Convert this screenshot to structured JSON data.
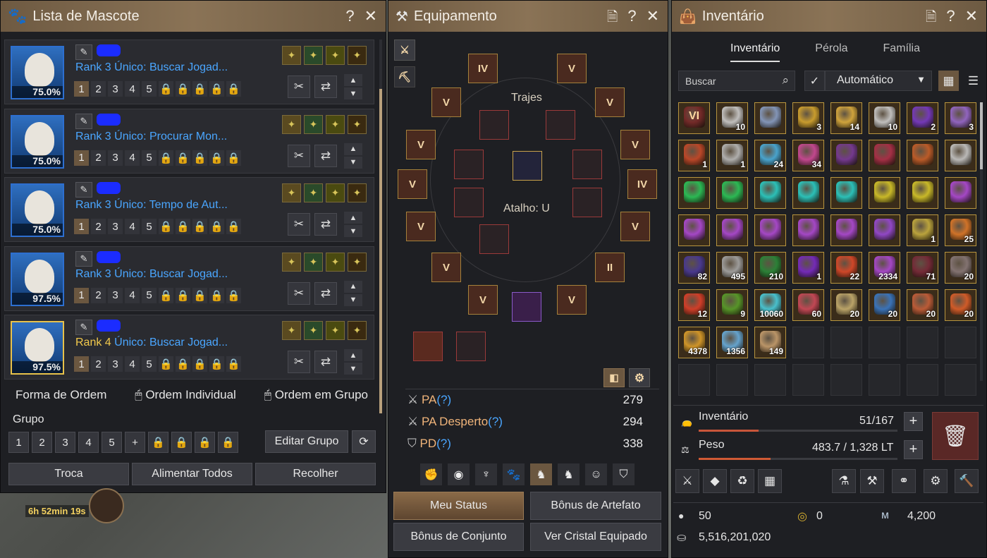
{
  "pets": {
    "title": "Lista de Mascote",
    "items": [
      {
        "pct": "75.0%",
        "rank": "Rank 3",
        "skill": "Único: Buscar Jogad...",
        "gold": false
      },
      {
        "pct": "75.0%",
        "rank": "Rank 3",
        "skill": "Único: Procurar Mon...",
        "gold": false
      },
      {
        "pct": "75.0%",
        "rank": "Rank 3",
        "skill": "Único: Tempo de Aut...",
        "gold": false
      },
      {
        "pct": "97.5%",
        "rank": "Rank 3",
        "skill": "Único: Buscar Jogad...",
        "gold": false
      },
      {
        "pct": "97.5%",
        "rank": "Rank 4",
        "skill": "Único: Buscar Jogad...",
        "gold": true
      }
    ],
    "slots": [
      "1",
      "2",
      "3",
      "4",
      "5"
    ],
    "order_label": "Forma de Ordem",
    "order_individual": "Ordem Individual",
    "order_group": "Ordem em Grupo",
    "group_label": "Grupo",
    "groups": [
      "1",
      "2",
      "3",
      "4",
      "5"
    ],
    "edit_group": "Editar Grupo",
    "trade": "Troca",
    "feed_all": "Alimentar Todos",
    "collect": "Recolher",
    "timer": "6h 52min 19s"
  },
  "equip": {
    "title": "Equipamento",
    "costumes": "Trajes",
    "shortcut": "Atalho: U",
    "stats": [
      {
        "label": "PA",
        "value": "279"
      },
      {
        "label": "PA Desperto",
        "value": "294"
      },
      {
        "label": "PD",
        "value": "338"
      }
    ],
    "q": "(?)",
    "my_status": "Meu Status",
    "artifact_bonus": "Bônus de Artefato",
    "set_bonus": "Bônus de Conjunto",
    "view_crystal": "Ver Cristal Equipado",
    "gear": [
      {
        "t": "IV"
      },
      {
        "t": "V"
      },
      {
        "t": "V"
      },
      {
        "t": "V"
      },
      {
        "t": "V"
      },
      {
        "t": "V"
      },
      {
        "t": "V"
      },
      {
        "t": "IV"
      },
      {
        "t": "V"
      },
      {
        "t": "V"
      },
      {
        "t": "V"
      },
      {
        "t": "II"
      },
      {
        "t": "V"
      },
      {
        "t": "V"
      }
    ]
  },
  "inv": {
    "title": "Inventário",
    "tabs": [
      "Inventário",
      "Pérola",
      "Família"
    ],
    "search_placeholder": "Buscar",
    "sort": "Automático",
    "inventory_label": "Inventário",
    "inventory_count": "51/167",
    "weight_label": "Peso",
    "weight_value": "483.7 / 1,328 LT",
    "pearls": "50",
    "coins": "0",
    "energy": "4,200",
    "silver": "5,516,201,020",
    "items": [
      {
        "c": "#7a2a2a",
        "n": "",
        "t": "VI"
      },
      {
        "c": "#cfcfcf",
        "n": "10"
      },
      {
        "c": "#8aa0c8",
        "n": ""
      },
      {
        "c": "#d8a830",
        "n": "3"
      },
      {
        "c": "#e0b040",
        "n": "14"
      },
      {
        "c": "#cfcfcf",
        "n": "10"
      },
      {
        "c": "#7a3ac8",
        "n": "2"
      },
      {
        "c": "#9a6ad0",
        "n": "3"
      },
      {
        "c": "#c84a2a",
        "n": "1"
      },
      {
        "c": "#bcbcbc",
        "n": "1"
      },
      {
        "c": "#4ab0e0",
        "n": "24"
      },
      {
        "c": "#d04a9a",
        "n": "34"
      },
      {
        "c": "#7a3a9a",
        "n": ""
      },
      {
        "c": "#b0304a",
        "n": ""
      },
      {
        "c": "#c8602a",
        "n": ""
      },
      {
        "c": "#c8c8c8",
        "n": ""
      },
      {
        "c": "#2ac85a",
        "n": ""
      },
      {
        "c": "#2ac85a",
        "n": ""
      },
      {
        "c": "#2ad0c8",
        "n": ""
      },
      {
        "c": "#2ad0c8",
        "n": ""
      },
      {
        "c": "#2ad0c8",
        "n": ""
      },
      {
        "c": "#d8c82a",
        "n": ""
      },
      {
        "c": "#d8c82a",
        "n": ""
      },
      {
        "c": "#b04ad8",
        "n": ""
      },
      {
        "c": "#b04ad8",
        "n": ""
      },
      {
        "c": "#b04ad8",
        "n": ""
      },
      {
        "c": "#b04ad8",
        "n": ""
      },
      {
        "c": "#b04ad8",
        "n": ""
      },
      {
        "c": "#b04ad8",
        "n": ""
      },
      {
        "c": "#9a4ad8",
        "n": ""
      },
      {
        "c": "#c8b040",
        "n": "1"
      },
      {
        "c": "#e07a2a",
        "n": "25"
      },
      {
        "c": "#4a3a9a",
        "n": "82"
      },
      {
        "c": "#a8a8a8",
        "n": "495"
      },
      {
        "c": "#2a8a3a",
        "n": "210"
      },
      {
        "c": "#7a2ac8",
        "n": "1"
      },
      {
        "c": "#e04a2a",
        "n": "22"
      },
      {
        "c": "#b04ad8",
        "n": "2334"
      },
      {
        "c": "#7a2a3a",
        "n": "71"
      },
      {
        "c": "#8a7a7a",
        "n": "20"
      },
      {
        "c": "#e0402a",
        "n": "12"
      },
      {
        "c": "#5aa02a",
        "n": "9"
      },
      {
        "c": "#4ad0e0",
        "n": "10060"
      },
      {
        "c": "#d04a5a",
        "n": "60"
      },
      {
        "c": "#c8b070",
        "n": "20"
      },
      {
        "c": "#3a7ac8",
        "n": "20"
      },
      {
        "c": "#c8603a",
        "n": "20"
      },
      {
        "c": "#e0602a",
        "n": "20"
      },
      {
        "c": "#e0a02a",
        "n": "4378"
      },
      {
        "c": "#6ab0e0",
        "n": "1356"
      },
      {
        "c": "#c8a070",
        "n": "149"
      },
      {
        "c": "",
        "n": ""
      },
      {
        "c": "",
        "n": ""
      },
      {
        "c": "",
        "n": ""
      },
      {
        "c": "",
        "n": ""
      },
      {
        "c": "",
        "n": ""
      },
      {
        "c": "",
        "n": ""
      },
      {
        "c": "",
        "n": ""
      },
      {
        "c": "",
        "n": ""
      },
      {
        "c": "",
        "n": ""
      },
      {
        "c": "",
        "n": ""
      },
      {
        "c": "",
        "n": ""
      },
      {
        "c": "",
        "n": ""
      },
      {
        "c": "",
        "n": ""
      }
    ]
  }
}
